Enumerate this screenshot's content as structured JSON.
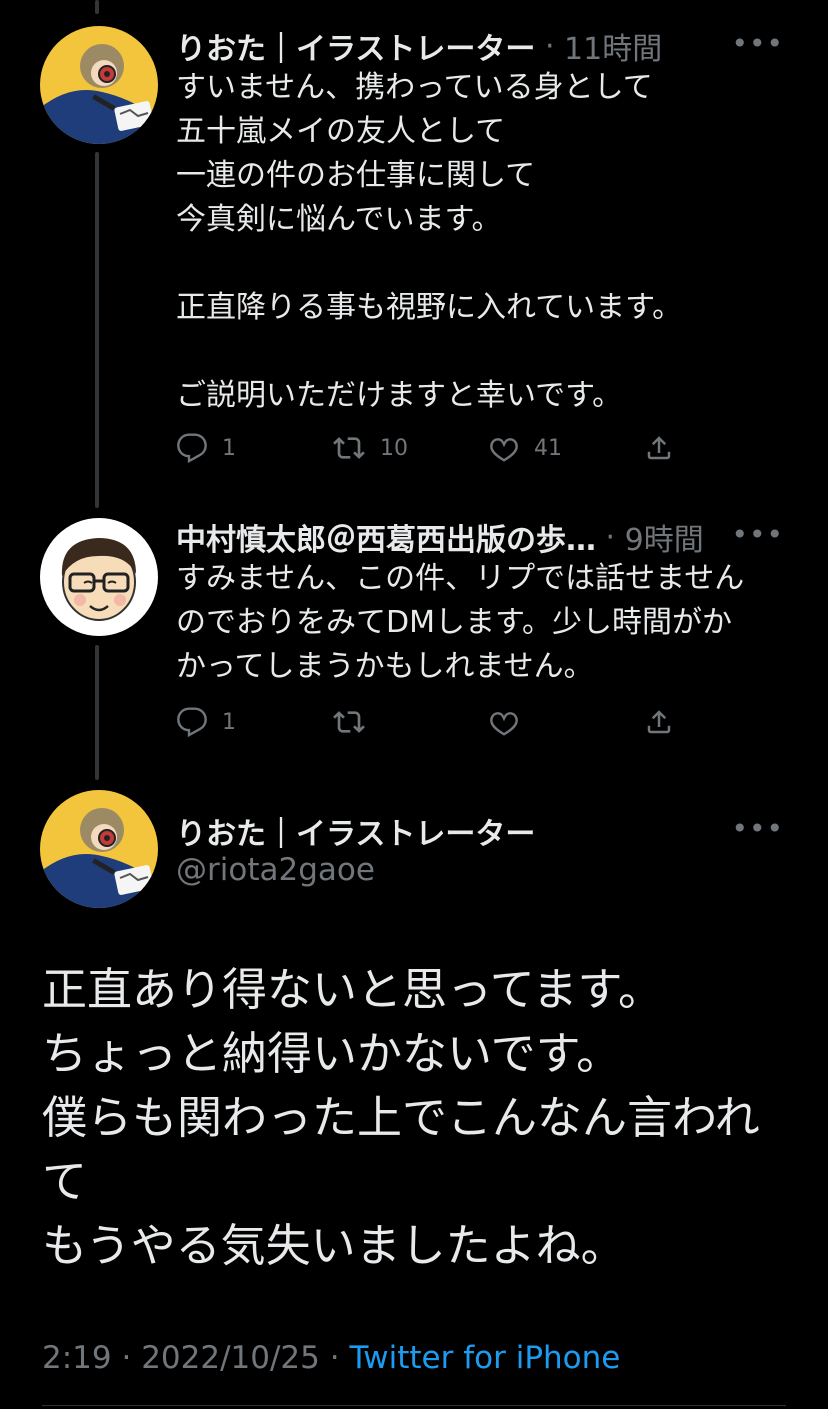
{
  "tweets": [
    {
      "name": "りおた｜イラストレーター",
      "time": "11時間",
      "text": "すいません、携わっている身として\n五十嵐メイの友人として\n一連の件のお仕事に関して\n今真剣に悩んでいます。\n\n正直降りる事も視野に入れています。\n\nご説明いただけますと幸いです。",
      "replies": "1",
      "retweets": "10",
      "likes": "41"
    },
    {
      "name": "中村慎太郎＠西葛西出版の歩…",
      "time": "9時間",
      "text": "すみません、この件、リプでは話せません\nのでおりをみてDMします。少し時間がか\nかってしまうかもしれません。",
      "replies": "1",
      "retweets": "",
      "likes": ""
    }
  ],
  "main": {
    "name": "りおた｜イラストレーター",
    "handle": "@riota2gaoe",
    "text": "正直あり得ないと思ってます。\nちょっと納得いかないです。\n僕らも関わった上でこんなん言われ\nて\nもうやる気失いましたよね。",
    "time": "2:19",
    "date": "2022/10/25",
    "source": "Twitter for iPhone"
  },
  "icons": [
    "reply-icon",
    "retweet-icon",
    "like-icon",
    "share-icon",
    "more-icon"
  ],
  "colors": {
    "background": "#000000",
    "text": "#e7e9ea",
    "muted": "#71767b",
    "link": "#1d9bf0"
  }
}
